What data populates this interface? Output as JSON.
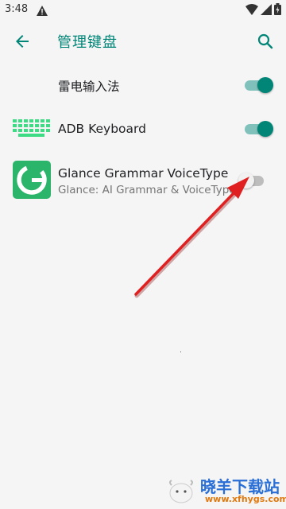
{
  "status_bar": {
    "time": "3:48",
    "icons": [
      "warning-icon",
      "wifi-icon",
      "signal-icon",
      "battery-icon"
    ]
  },
  "app_bar": {
    "title": "管理键盘",
    "back_icon": "arrow-back-icon",
    "search_icon": "search-icon",
    "accent_color": "#008577"
  },
  "keyboards": [
    {
      "title": "雷电输入法",
      "subtitle": "",
      "enabled": true,
      "icon": "none"
    },
    {
      "title": "ADB Keyboard",
      "subtitle": "",
      "enabled": true,
      "icon": "keyboard-icon"
    },
    {
      "title": "Glance Grammar VoiceType",
      "subtitle": "Glance: AI Grammar & VoiceType",
      "enabled": false,
      "icon": "glance-g-icon"
    }
  ],
  "annotation": {
    "arrow_color": "#e02020",
    "arrow_icon": "red-arrow-annotation"
  },
  "watermark": {
    "text": "晓羊下载站",
    "url": "www.xfhygs.com"
  }
}
